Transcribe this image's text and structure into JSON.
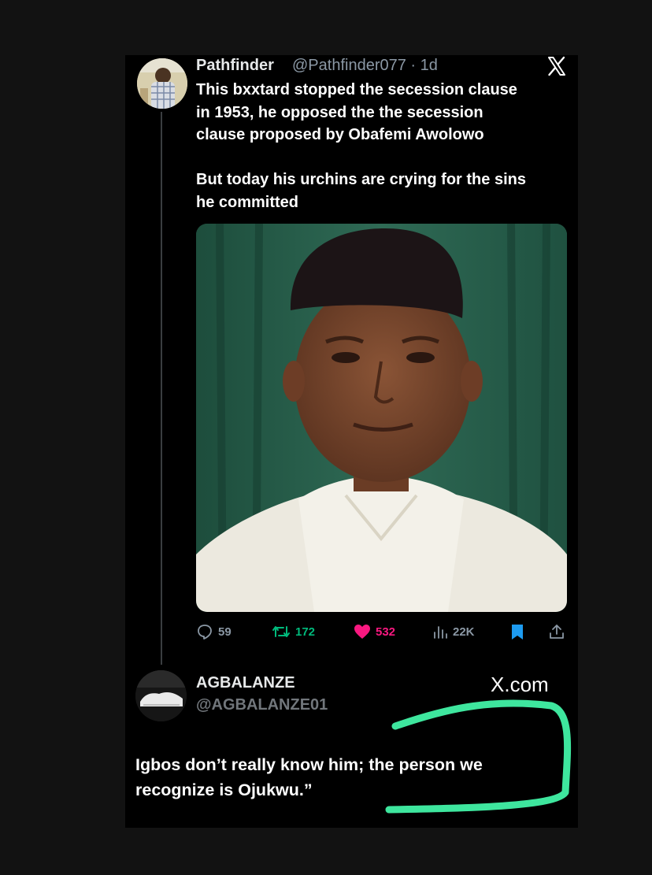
{
  "tweet": {
    "author_name": "Pathfinder",
    "author_handle_time": "@Pathfinder077 · 1d",
    "text_lines": [
      "This bxxtard stopped the secession clause",
      "in 1953, he opposed the the secession",
      "clause proposed by Obafemi Awolowo",
      "",
      "But today his urchins are crying for the sins",
      "he committed"
    ],
    "metrics": {
      "replies": "59",
      "reposts": "172",
      "likes": "532",
      "views": "22K"
    }
  },
  "reply": {
    "author_name": "AGBALANZE",
    "author_handle": "@AGBALANZE01",
    "source": "X.com",
    "text_lines": [
      "Igbos don’t really know him; the person we",
      "recognize is Ojukwu.”"
    ]
  },
  "icons": [
    "x-logo-icon",
    "reply-icon",
    "repost-icon",
    "like-icon",
    "views-icon",
    "bookmark-icon",
    "share-icon"
  ],
  "colors": {
    "background": "#000000",
    "page_border": "#121212",
    "repost": "#00ba7c",
    "like": "#f91880",
    "bookmark": "#1d9bf0",
    "secondary_text": "#8b98a5",
    "highlight_stroke": "#3ee69e"
  }
}
